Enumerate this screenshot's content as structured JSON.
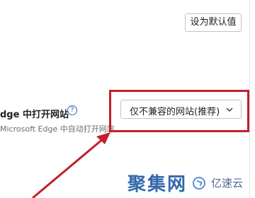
{
  "header": {
    "reset_button_label": "设为默认值"
  },
  "setting": {
    "title": "dge 中打开网站",
    "help_icon": "?",
    "description": "Microsoft Edge 中自动打开网站",
    "dropdown_value": "仅不兼容的网站(推荐)"
  },
  "annotation": {
    "highlight_color": "#c0212b",
    "arrow_color": "#c0212b"
  },
  "watermark": {
    "primary": "聚集网",
    "secondary": "亿速云"
  }
}
